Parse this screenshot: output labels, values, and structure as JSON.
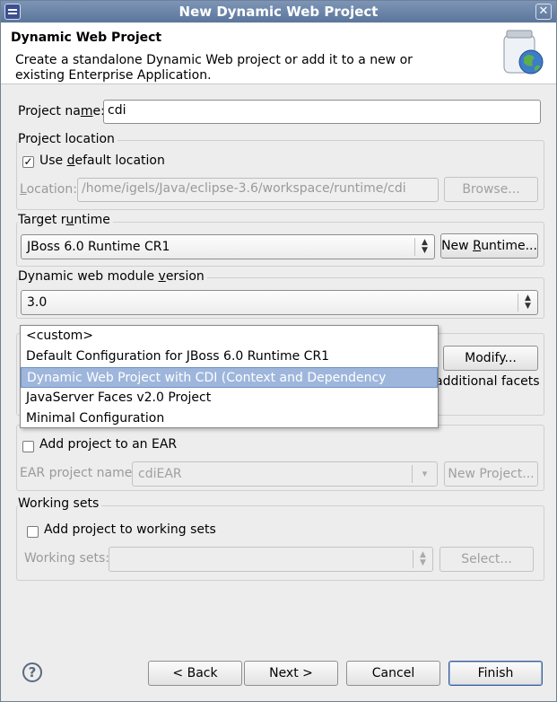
{
  "window": {
    "title": "New Dynamic Web Project"
  },
  "header": {
    "title": "Dynamic Web Project",
    "description": "Create a standalone Dynamic Web project or add it to a new or existing Enterprise Application."
  },
  "project_name": {
    "label_pre": "Project na",
    "label_mn": "m",
    "label_post": "e:",
    "value": "cdi"
  },
  "project_location": {
    "group_label": "Project location",
    "use_default_pre": "Use ",
    "use_default_mn": "d",
    "use_default_post": "efault location",
    "use_default_checked": "✓",
    "location_label_pre": "",
    "location_label_mn": "L",
    "location_label_post": "ocation:",
    "location_value": "/home/igels/Java/eclipse-3.6/workspace/runtime/cdi",
    "browse_label": "Browse..."
  },
  "target_runtime": {
    "group_label_pre": "Target r",
    "group_label_mn": "u",
    "group_label_post": "ntime",
    "value": "JBoss 6.0 Runtime CR1",
    "new_runtime_pre": "New ",
    "new_runtime_mn": "R",
    "new_runtime_post": "untime..."
  },
  "module_version": {
    "group_label_pre": "Dynamic web module ",
    "group_label_mn": "v",
    "group_label_post": "ersion",
    "value": "3.0"
  },
  "configuration": {
    "modify_label": "Modify...",
    "hint_fragment": "additional facets",
    "options": [
      "<custom>",
      "Default Configuration for JBoss 6.0 Runtime CR1",
      "Dynamic Web Project with CDI (Context and Dependency Injection)",
      "JavaServer Faces v2.0 Project",
      "Minimal Configuration"
    ],
    "selected_index": 2
  },
  "ear": {
    "add_label": "Add project to an EAR",
    "name_label": "EAR project name:",
    "name_value": "cdiEAR",
    "new_project_label": "New Project..."
  },
  "working_sets": {
    "group_label": "Working sets",
    "add_label": "Add project to working sets",
    "sets_label": "Working sets:",
    "sets_value": "",
    "select_label": "Select..."
  },
  "footer": {
    "help_glyph": "?",
    "back_label": "< Back",
    "next_label": "Next >",
    "cancel_label": "Cancel",
    "finish_label": "Finish"
  }
}
